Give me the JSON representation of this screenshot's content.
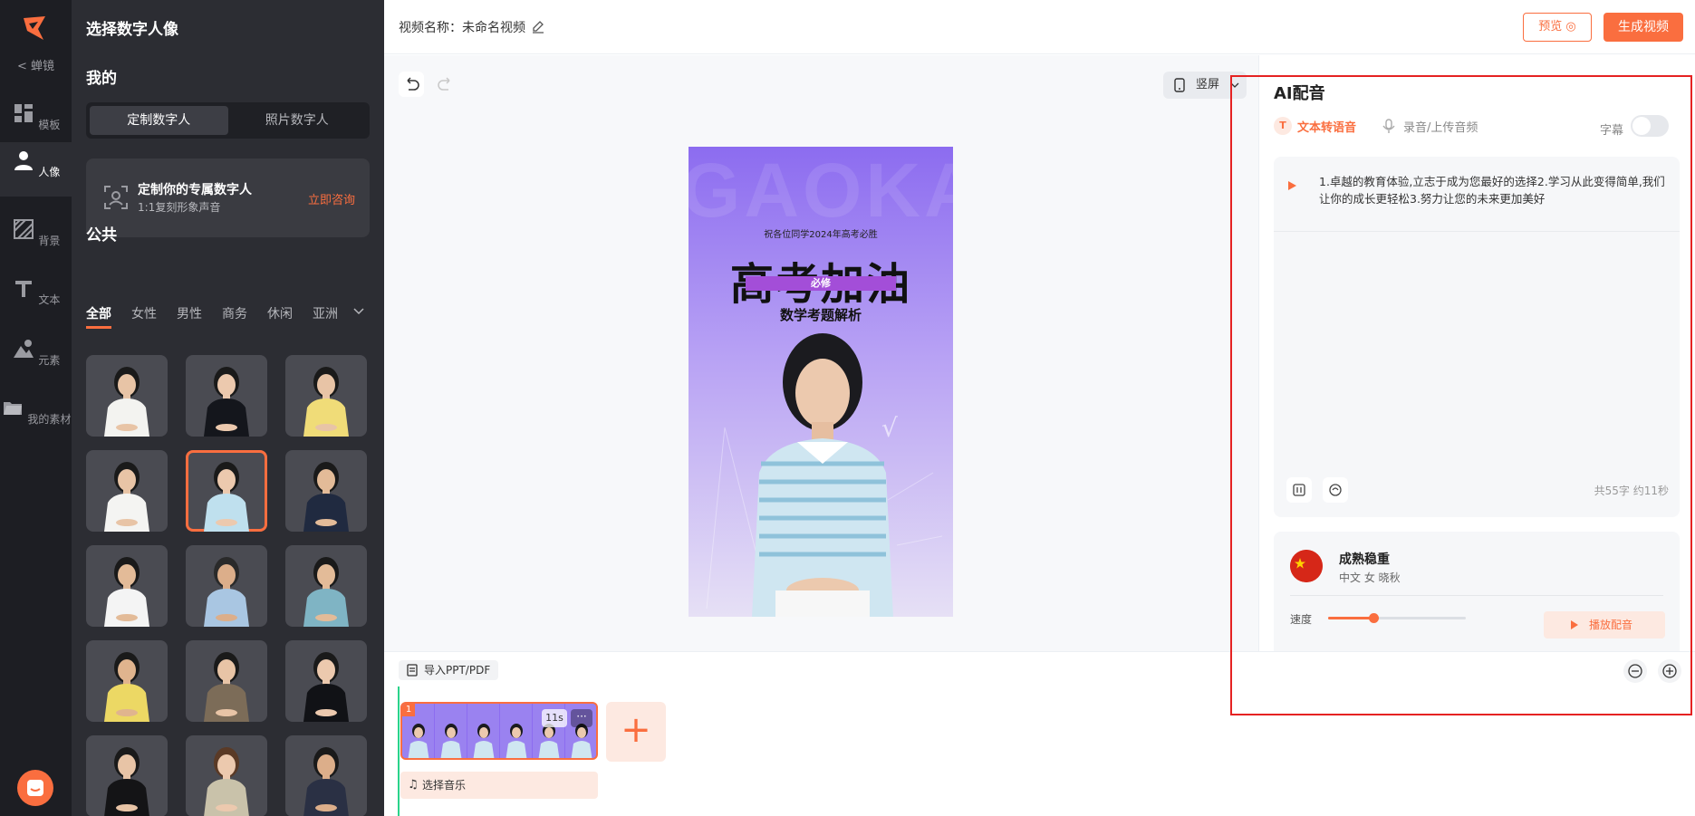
{
  "rail": {
    "back_label": "< 蝉镜",
    "items": [
      {
        "label": "模板",
        "icon": "template-icon"
      },
      {
        "label": "人像",
        "icon": "person-icon"
      },
      {
        "label": "背景",
        "icon": "background-icon"
      },
      {
        "label": "文本",
        "icon": "text-icon"
      },
      {
        "label": "元素",
        "icon": "elements-icon"
      },
      {
        "label": "我的素材",
        "icon": "folder-icon"
      }
    ],
    "active_index": 1
  },
  "panel": {
    "title": "选择数字人像",
    "mine_heading": "我的",
    "segments": [
      "定制数字人",
      "照片数字人"
    ],
    "promo": {
      "title": "定制你的专属数字人",
      "subtitle": "1:1复刻形象声音",
      "cta": "立即咨询"
    },
    "public_heading": "公共",
    "filters": [
      "全部",
      "女性",
      "男性",
      "商务",
      "休闲",
      "亚洲"
    ],
    "active_filter": 0,
    "avatars": [
      {
        "name": "avatar-1",
        "shirt": "#f3f3f0",
        "hair": "#1a1a1a",
        "skin": "#e8c4a6"
      },
      {
        "name": "avatar-2",
        "shirt": "#14161c",
        "hair": "#1a1a1a",
        "skin": "#ecc9ae"
      },
      {
        "name": "avatar-3",
        "shirt": "#f0dc78",
        "hair": "#1a1a1a",
        "skin": "#e8c4a6"
      },
      {
        "name": "avatar-4",
        "shirt": "#f4f4f2",
        "hair": "#1a1a1a",
        "skin": "#e8c4a6"
      },
      {
        "name": "avatar-5",
        "shirt": "#bfe0ee",
        "hair": "#1a1a1a",
        "skin": "#ecc9ae",
        "selected": true
      },
      {
        "name": "avatar-6",
        "shirt": "#202a40",
        "hair": "#1a1a1a",
        "skin": "#e3bb98"
      },
      {
        "name": "avatar-7",
        "shirt": "#f4f4f4",
        "hair": "#1a1a1a",
        "skin": "#e3bb98"
      },
      {
        "name": "avatar-8",
        "shirt": "#a9c6e2",
        "hair": "#2a2a2a",
        "skin": "#dcae8a"
      },
      {
        "name": "avatar-9",
        "shirt": "#7fb4c4",
        "hair": "#1a1a1a",
        "skin": "#e3bb98"
      },
      {
        "name": "avatar-10",
        "shirt": "#ecd864",
        "hair": "#1a1a1a",
        "skin": "#e0b48e"
      },
      {
        "name": "avatar-11",
        "shirt": "#7c6c58",
        "hair": "#1a1a1a",
        "skin": "#e8c4a6"
      },
      {
        "name": "avatar-12",
        "shirt": "#111216",
        "hair": "#1a1a1a",
        "skin": "#ecc9ae"
      },
      {
        "name": "avatar-13",
        "shirt": "#141416",
        "hair": "#1a1a1a",
        "skin": "#e8c4a6"
      },
      {
        "name": "avatar-14",
        "shirt": "#c9c2aa",
        "hair": "#5a3a26",
        "skin": "#ecc9ae"
      },
      {
        "name": "avatar-15",
        "shirt": "#2a3044",
        "hair": "#1a1a1a",
        "skin": "#dcae8a"
      }
    ]
  },
  "topbar": {
    "video_name": "视频名称：未命名视频",
    "preview_label": "预览 ◎",
    "generate_label": "生成视频"
  },
  "canvas": {
    "orientation_label": "竖屏",
    "poster": {
      "bg_word": "GAOKAO",
      "line1": "祝各位同学2024年高考必胜",
      "headline": "高考加油",
      "tag": "必修",
      "subtitle": "数学考题解析"
    }
  },
  "timeline": {
    "import_label": "导入PPT/PDF",
    "clip_index": "1",
    "clip_duration": "11s",
    "clip_more": "···",
    "add_label": "+",
    "music_label": "选择音乐"
  },
  "ai_dub": {
    "title": "AI配音",
    "tab_tts": "文本转语音",
    "tab_tts_icon": "T",
    "tab_record": "录音/上传音频",
    "subtitle_label": "字幕",
    "subtitle_on": false,
    "script_text": "1.卓越的教育体验,立志于成为您最好的选择2.学习从此变得简单,我们让你的成长更轻松3.努力让您的未来更加美好",
    "count_label": "共55字 约11秒",
    "voice": {
      "name": "成熟稳重",
      "desc": "中文  女  晓秋",
      "speed_label": "速度",
      "speed_fraction": 0.33,
      "play_label": "播放配音"
    }
  },
  "colors": {
    "accent": "#fa6e3f",
    "rail_bg": "#1d1e23",
    "panel_bg": "#2c2d33",
    "highlight": "#e52222"
  }
}
